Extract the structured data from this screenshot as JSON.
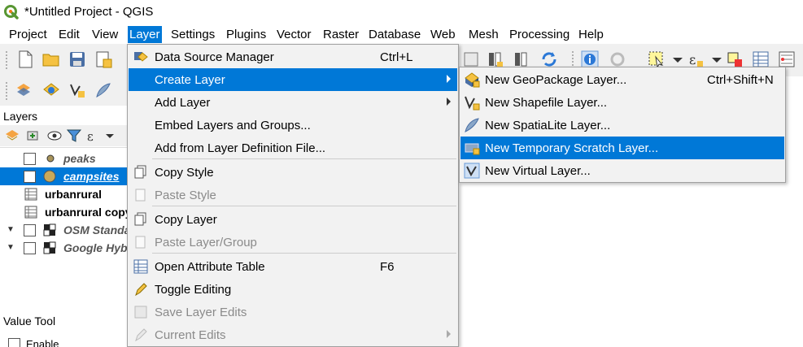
{
  "window": {
    "title": "*Untitled Project - QGIS"
  },
  "menubar": {
    "items": [
      "Project",
      "Edit",
      "View",
      "Layer",
      "Settings",
      "Plugins",
      "Vector",
      "Raster",
      "Database",
      "Web",
      "Mesh",
      "Processing",
      "Help"
    ],
    "active": "Layer"
  },
  "layers_panel": {
    "title": "Layers",
    "rows": [
      {
        "name": "peaks"
      },
      {
        "name": "campsites"
      },
      {
        "name": "urbanrural"
      },
      {
        "name": "urbanrural copy"
      },
      {
        "name": "OSM Standard"
      },
      {
        "name": "Google Hybrid"
      }
    ]
  },
  "value_tool": {
    "title": "Value Tool",
    "enable_label": "Enable"
  },
  "layer_menu": {
    "items": [
      {
        "label": "Data Source Manager",
        "shortcut": "Ctrl+L"
      },
      {
        "label": "Create Layer"
      },
      {
        "label": "Add Layer"
      },
      {
        "label": "Embed Layers and Groups..."
      },
      {
        "label": "Add from Layer Definition File..."
      },
      {
        "label": "Copy Style"
      },
      {
        "label": "Paste Style"
      },
      {
        "label": "Copy Layer"
      },
      {
        "label": "Paste Layer/Group"
      },
      {
        "label": "Open Attribute Table",
        "shortcut": "F6"
      },
      {
        "label": "Toggle Editing"
      },
      {
        "label": "Save Layer Edits"
      },
      {
        "label": "Current Edits"
      }
    ]
  },
  "create_layer_submenu": {
    "items": [
      {
        "label": "New GeoPackage Layer...",
        "shortcut": "Ctrl+Shift+N"
      },
      {
        "label": "New Shapefile Layer..."
      },
      {
        "label": "New SpatiaLite Layer..."
      },
      {
        "label": "New Temporary Scratch Layer..."
      },
      {
        "label": "New Virtual Layer..."
      }
    ]
  },
  "colors": {
    "highlight": "#0078d7",
    "menu_bg": "#f2f2f2",
    "qgis_green": "#589632"
  }
}
